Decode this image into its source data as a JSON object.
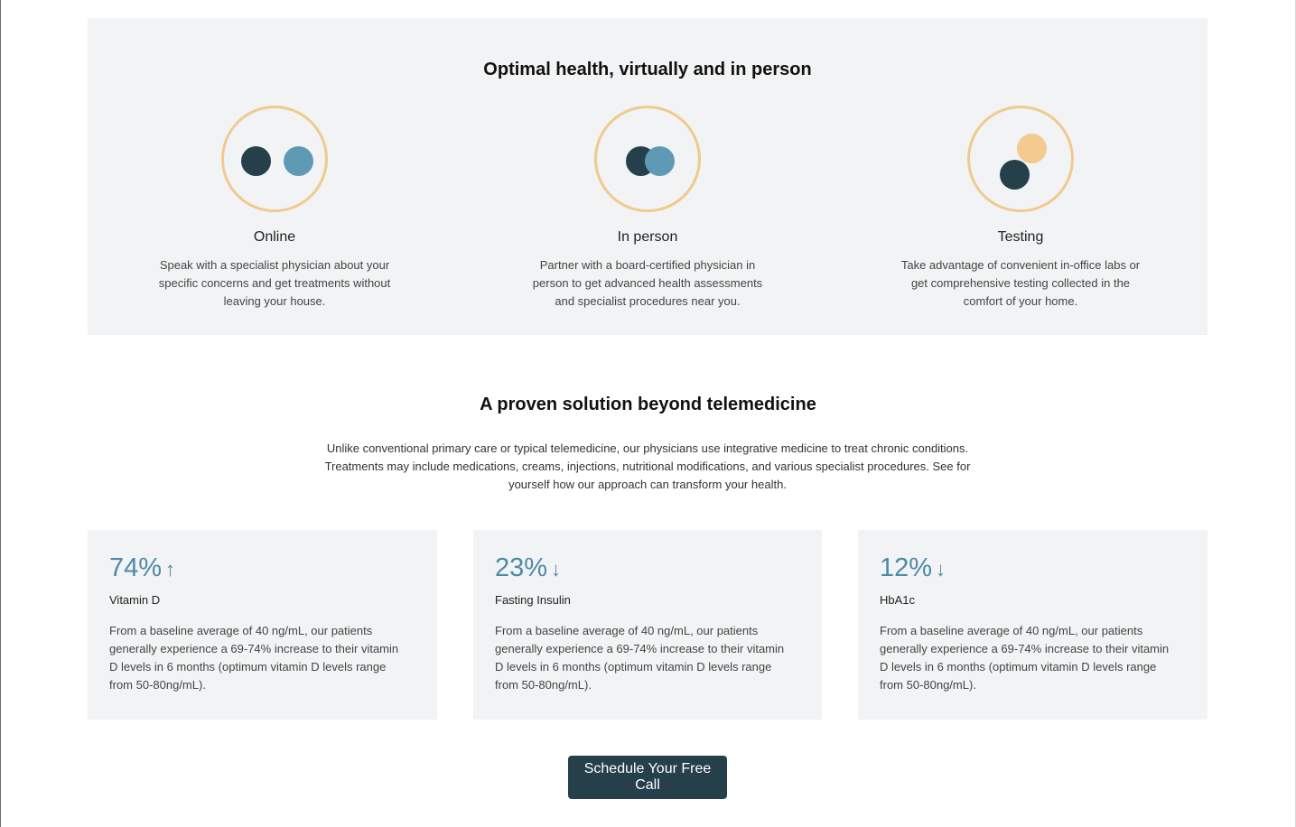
{
  "care_section": {
    "title": "Optimal health, virtually and in person",
    "modes": [
      {
        "title": "Online",
        "description": "Speak with a specialist physician about your specific concerns and get treatments without leaving your house.",
        "icon": "two-separate-dots-icon"
      },
      {
        "title": "In person",
        "description": "Partner with a board-certified physician in person to get advanced health assessments and specialist procedures near you.",
        "icon": "overlapping-dots-icon"
      },
      {
        "title": "Testing",
        "description": "Take advantage of convenient in-office labs or get comprehensive testing collected in the comfort of your home.",
        "icon": "stacked-dots-icon"
      }
    ]
  },
  "results_section": {
    "title": "A proven solution beyond telemedicine",
    "description": "Unlike conventional primary care or typical telemedicine, our physicians use integrative medicine to treat chronic conditions. Treatments may include medications, creams, injections, nutritional modifications, and various specialist procedures. See for yourself how our approach can transform your health.",
    "stats": [
      {
        "value": "74%",
        "arrow": "↑",
        "label": "Vitamin D",
        "description": "From a baseline average of 40 ng/mL, our patients generally experience a 69-74% increase to their vitamin D levels in 6 months (optimum vitamin D levels range from 50-80ng/mL)."
      },
      {
        "value": "23%",
        "arrow": "↓",
        "label": "Fasting Insulin",
        "description": "From a baseline average of 40 ng/mL, our patients generally experience a 69-74% increase to their vitamin D levels in 6 months (optimum vitamin D levels range from 50-80ng/mL)."
      },
      {
        "value": "12%",
        "arrow": "↓",
        "label": "HbA1c",
        "description": "From a baseline average of 40 ng/mL, our patients generally experience a 69-74% increase to their vitamin D levels in 6 months (optimum vitamin D levels range from 50-80ng/mL)."
      }
    ]
  },
  "cta": {
    "label": "Schedule Your Free Call"
  },
  "colors": {
    "dark": "#253f4b",
    "blue": "#5e9ab4",
    "gold": "#f3ca90",
    "ring": "#f0ca8e",
    "panel": "#f2f3f4",
    "accent_text": "#4d89a6"
  }
}
